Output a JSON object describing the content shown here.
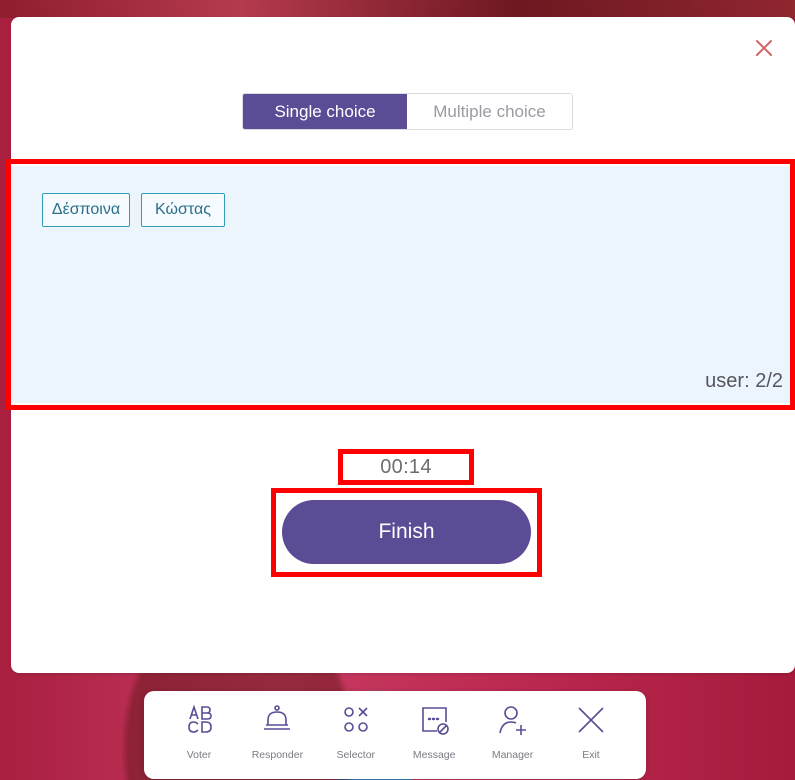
{
  "colors": {
    "accent": "#5b4c95",
    "chip_border": "#2f9fb7",
    "chip_text": "#2b6f88",
    "panel_bg": "#edf5fc",
    "annotation": "#ff0000",
    "background": "#b8284a"
  },
  "dialog": {
    "close_icon": "close-icon",
    "modes": {
      "single": "Single choice",
      "multiple": "Multiple choice",
      "selected": "Single choice"
    },
    "participants": [
      "Δέσποινα",
      "Κώστας"
    ],
    "user_count": "user: 2/2",
    "timer": "00:14",
    "finish_label": "Finish"
  },
  "toolbar": {
    "items": [
      {
        "label": "Voter",
        "icon": "abcd-grid-icon"
      },
      {
        "label": "Responder",
        "icon": "bell-icon"
      },
      {
        "label": "Selector",
        "icon": "circles-cross-icon"
      },
      {
        "label": "Message",
        "icon": "message-icon"
      },
      {
        "label": "Manager",
        "icon": "add-user-icon"
      },
      {
        "label": "Exit",
        "icon": "close-icon"
      }
    ]
  }
}
